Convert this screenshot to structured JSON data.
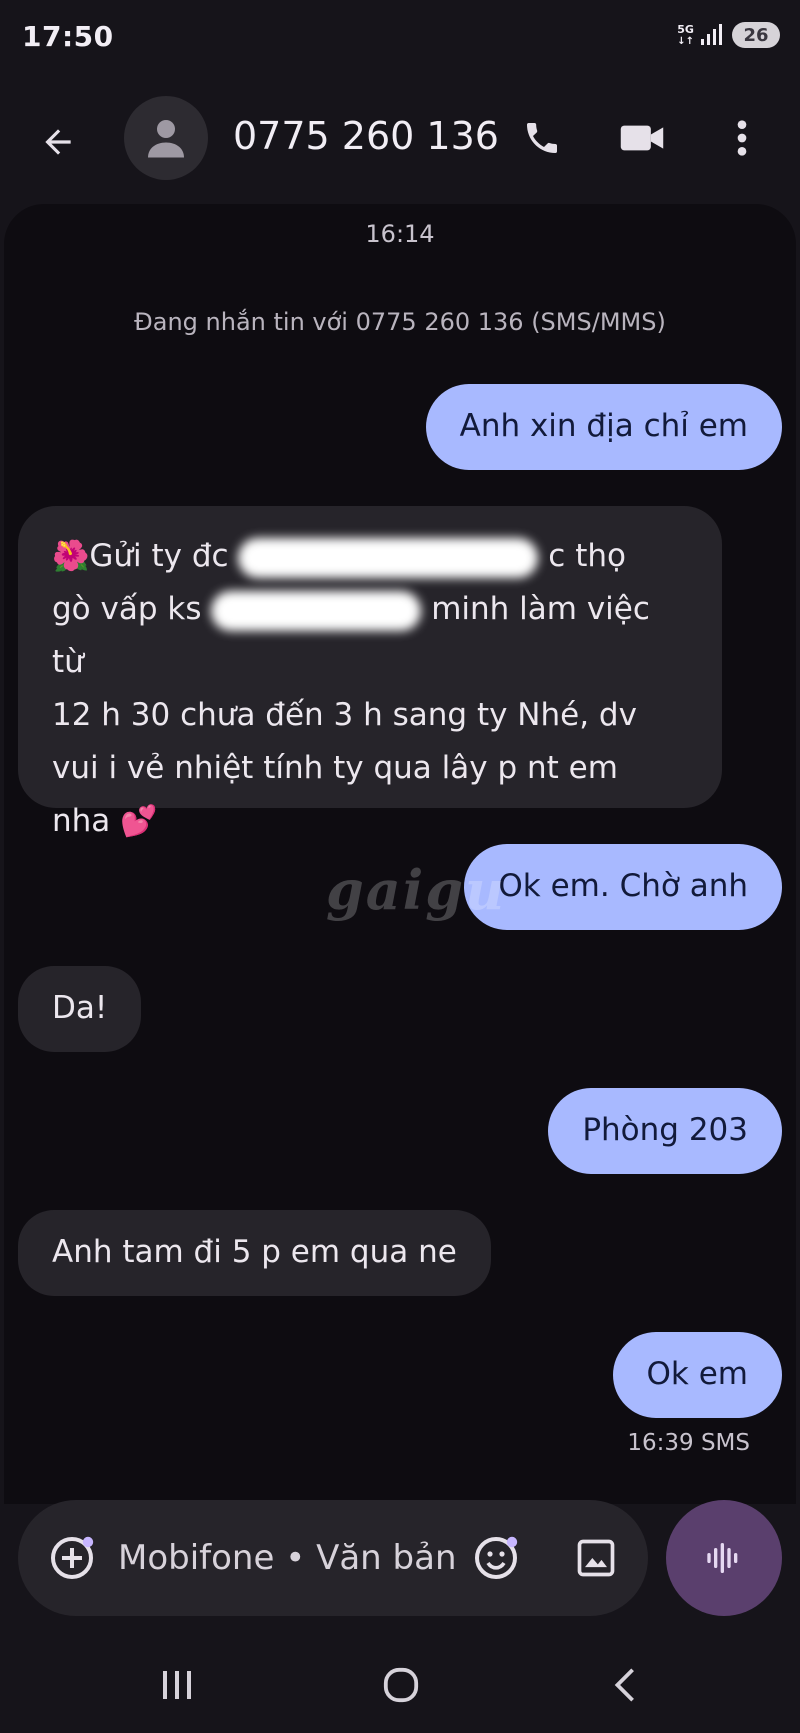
{
  "status_bar": {
    "time": "17:50",
    "network": "5G",
    "battery": "26"
  },
  "header": {
    "contact": "0775 260 136"
  },
  "conversation": {
    "start_time": "16:14",
    "info": "Đang nhắn tin với 0775 260 136 (SMS/MMS)"
  },
  "messages": [
    {
      "direction": "out",
      "text": "Anh xin địa chỉ em"
    },
    {
      "direction": "in",
      "lines": [
        {
          "prefix": "Gửi ty đc",
          "suffix": "c thọ"
        },
        {
          "prefix": "gò vấp ks",
          "suffix": "minh làm việc từ"
        },
        {
          "text": "12 h 30  chưa đến 3 h sang ty Nhé, dv"
        },
        {
          "text": "vui i vẻ nhiệt tính  ty  qua lây p nt em"
        },
        {
          "text": "nha"
        }
      ],
      "lead_emoji": "🌺",
      "trail_emoji": "💕"
    },
    {
      "direction": "out",
      "text": "Ok em. Chờ anh"
    },
    {
      "direction": "in",
      "text": "Da!"
    },
    {
      "direction": "out",
      "text": "Phòng 203"
    },
    {
      "direction": "in",
      "text": "Anh tam đi 5 p em qua ne"
    },
    {
      "direction": "out",
      "text": "Ok em",
      "meta": "16:39 SMS"
    }
  ],
  "watermark": "gaigu",
  "composer": {
    "placeholder": "Mobifone • Văn bản"
  }
}
